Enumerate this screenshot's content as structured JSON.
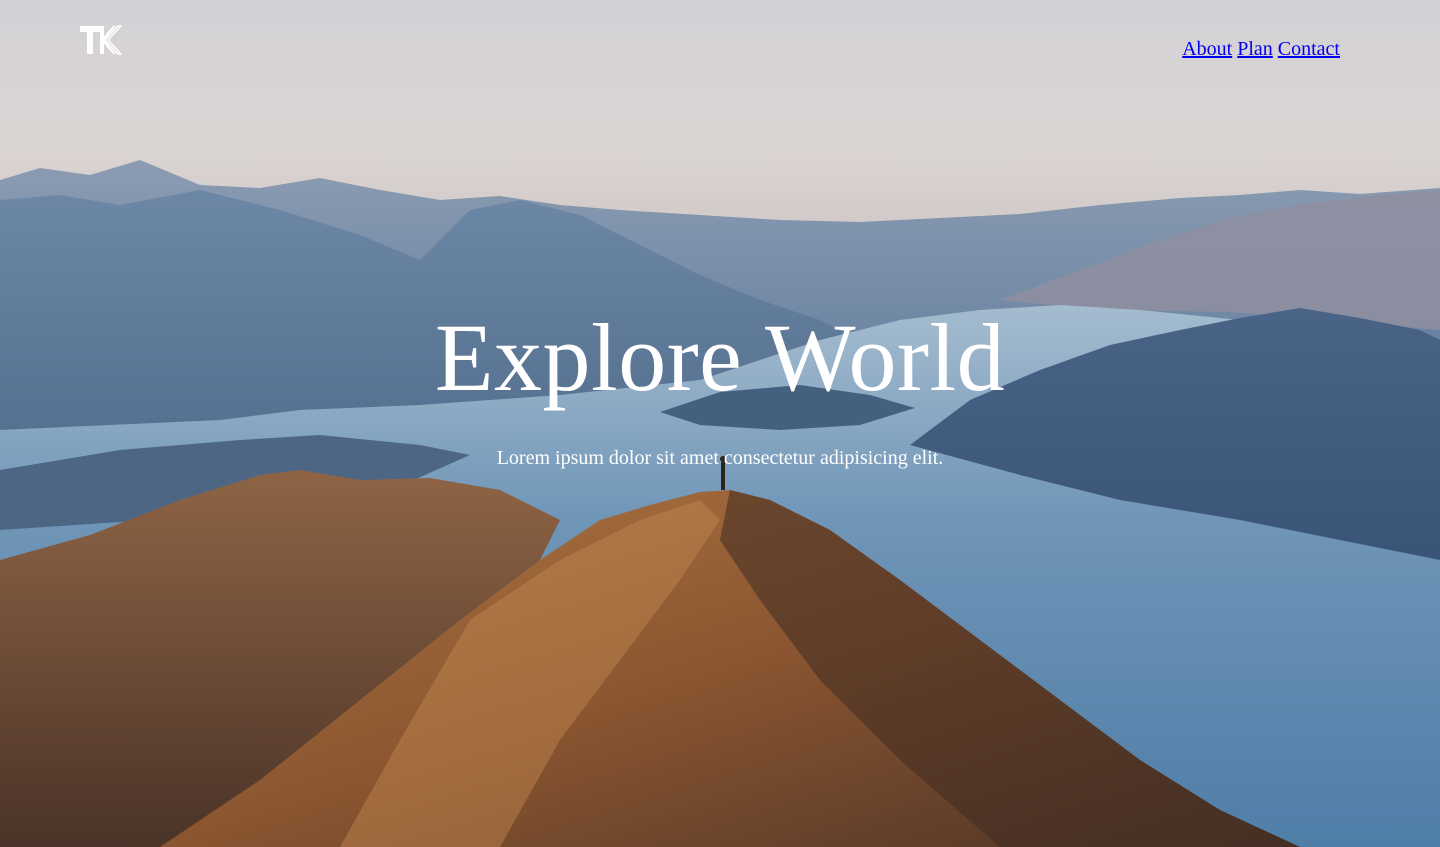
{
  "logo": {
    "icon": "tk-monogram-icon",
    "color": "#ffffff"
  },
  "nav": {
    "items": [
      {
        "label": "About"
      },
      {
        "label": "Plan"
      },
      {
        "label": "Contact"
      }
    ],
    "link_color": "#0000ee"
  },
  "hero": {
    "title": "Explore World",
    "subtitle": "Lorem ipsum dolor sit amet consectetur adipisicing elit.",
    "text_color": "#ffffff",
    "background": "mountain-lake-landscape-photo"
  }
}
